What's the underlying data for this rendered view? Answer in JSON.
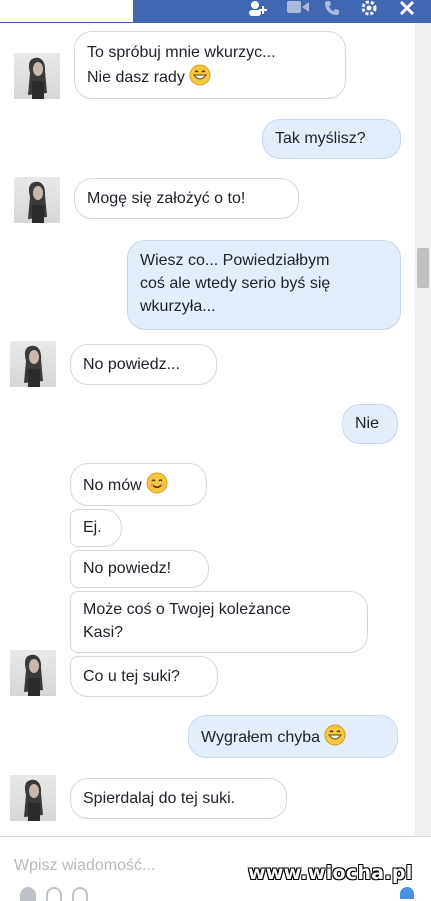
{
  "composer": {
    "placeholder": "Wpisz wiadomość..."
  },
  "watermark": "www.wiocha.pl",
  "icons": {
    "add_person": "add-person-icon",
    "video": "video-call-icon",
    "phone": "phone-icon",
    "settings": "gear-icon",
    "close": "close-icon",
    "emoji_smile": "grinning-emoji",
    "emoji_blush": "smiling-emoji"
  },
  "colors": {
    "header": "#4267b2",
    "outgoing_bubble": "#e4eefb",
    "incoming_bubble": "#ffffff"
  },
  "messages": [
    {
      "side": "in",
      "text": "To spróbuj mnie wkurzyc...",
      "text2": "Nie dasz rady",
      "emoji": "grinning-emoji"
    },
    {
      "side": "out",
      "text": "Tak myślisz?"
    },
    {
      "side": "in",
      "text": "Mogę się założyć o to!"
    },
    {
      "side": "out",
      "text": "Wiesz co... Powiedziałbym",
      "text2": "coś ale wtedy serio byś się",
      "text3": "wkurzyła..."
    },
    {
      "side": "in",
      "text": "No powiedz..."
    },
    {
      "side": "out",
      "text": "Nie"
    },
    {
      "side": "in",
      "text": "No mów",
      "emoji": "smiling-emoji"
    },
    {
      "side": "in",
      "text": "Ej."
    },
    {
      "side": "in",
      "text": "No powiedz!"
    },
    {
      "side": "in",
      "text": "Może coś o Twojej koleżance",
      "text2": "Kasi?"
    },
    {
      "side": "in",
      "text": "Co u tej suki?"
    },
    {
      "side": "out",
      "text": "Wygrałem chyba",
      "emoji": "grinning-emoji"
    },
    {
      "side": "in",
      "text": "Spierdalaj do tej suki."
    }
  ]
}
